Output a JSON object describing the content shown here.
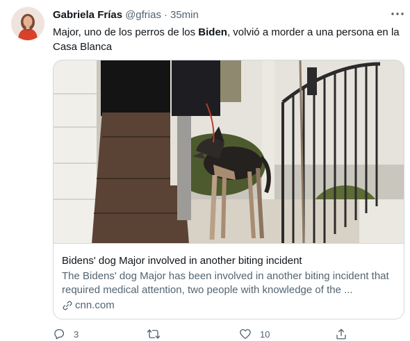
{
  "tweet": {
    "author_name": "Gabriela Frías",
    "handle": "@gfrias",
    "separator": "·",
    "time": "35min",
    "text_before": "Major, uno de los perros de los ",
    "text_bold": "Biden",
    "text_after": ", volvió a morder a una persona en la Casa Blanca"
  },
  "card": {
    "title": "Bidens' dog Major involved in another biting incident",
    "description": "The Bidens' dog Major has been involved in another biting incident that required medical attention, two people with knowledge of the ...",
    "domain": "cnn.com"
  },
  "actions": {
    "reply_count": "3",
    "retweet_count": "",
    "like_count": "10"
  },
  "icons": [
    "more-icon",
    "reply-icon",
    "retweet-icon",
    "like-icon",
    "share-icon",
    "link-icon"
  ]
}
